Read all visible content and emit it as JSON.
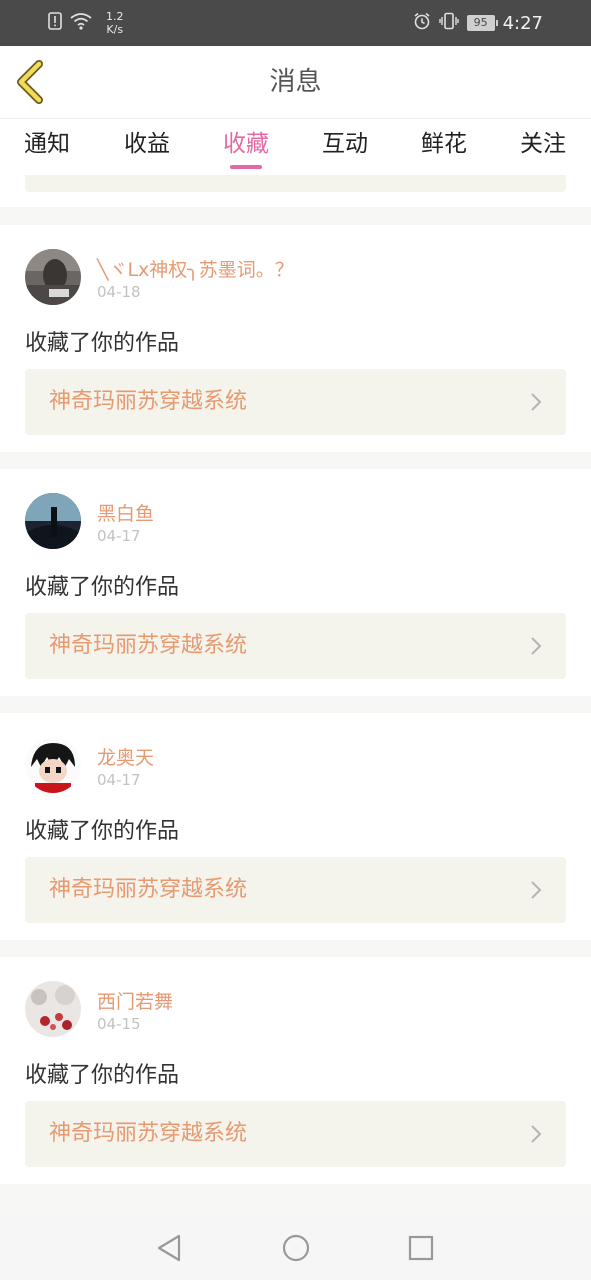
{
  "status_bar": {
    "net_speed_value": "1.2",
    "net_speed_unit": "K/s",
    "battery": "95",
    "time": "4:27"
  },
  "header": {
    "title": "消息"
  },
  "tabs": [
    {
      "label": "通知"
    },
    {
      "label": "收益"
    },
    {
      "label": "收藏",
      "active": true
    },
    {
      "label": "互动"
    },
    {
      "label": "鲜花"
    },
    {
      "label": "关注"
    }
  ],
  "colors": {
    "accent": "#e36aa4",
    "username": "#e69a72",
    "card_bg": "#f4f3ec"
  },
  "items": [
    {
      "username": "╲ヾLx神权╮苏墨词。？",
      "date": "04-18",
      "action": "收藏了你的作品",
      "work_title": "神奇玛丽苏穿越系统"
    },
    {
      "username": "黑白鱼",
      "date": "04-17",
      "action": "收藏了你的作品",
      "work_title": "神奇玛丽苏穿越系统"
    },
    {
      "username": "龙奥天",
      "date": "04-17",
      "action": "收藏了你的作品",
      "work_title": "神奇玛丽苏穿越系统"
    },
    {
      "username": "西门若舞",
      "date": "04-15",
      "action": "收藏了你的作品",
      "work_title": "神奇玛丽苏穿越系统"
    }
  ]
}
